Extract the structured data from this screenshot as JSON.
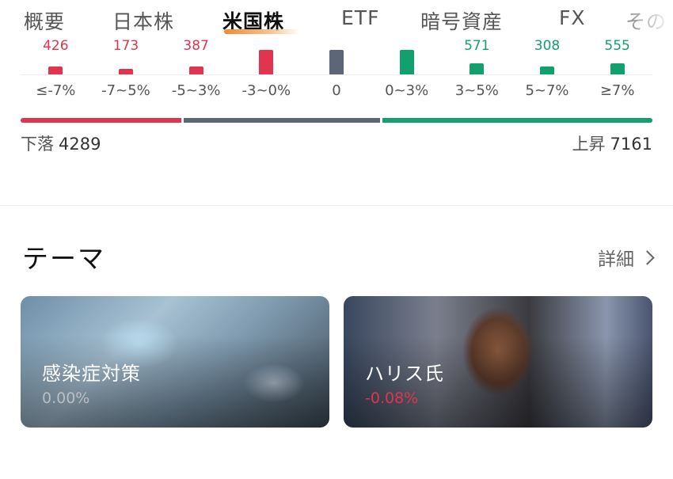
{
  "tabs": [
    {
      "label": "概要"
    },
    {
      "label": "日本株"
    },
    {
      "label": "米国株"
    },
    {
      "label": "ETF"
    },
    {
      "label": "暗号資産"
    },
    {
      "label": "FX"
    },
    {
      "label": "その"
    }
  ],
  "active_tab": "米国株",
  "distribution": {
    "buckets": [
      {
        "range": "≤-7%",
        "value": "426",
        "level": 0.28,
        "trend": "down"
      },
      {
        "range": "-7~5%",
        "value": "173",
        "level": 0.22,
        "trend": "down"
      },
      {
        "range": "-5~3%",
        "value": "387",
        "level": 0.28,
        "trend": "down"
      },
      {
        "range": "-3~0%",
        "value": "",
        "level": 0.9,
        "trend": "down"
      },
      {
        "range": "0",
        "value": "",
        "level": 0.9,
        "trend": "flat"
      },
      {
        "range": "0~3%",
        "value": "",
        "level": 0.9,
        "trend": "up"
      },
      {
        "range": "3~5%",
        "value": "571",
        "level": 0.4,
        "trend": "up"
      },
      {
        "range": "5~7%",
        "value": "308",
        "level": 0.3,
        "trend": "up"
      },
      {
        "range": "≥7%",
        "value": "555",
        "level": 0.42,
        "trend": "up"
      }
    ],
    "down_label": "下落",
    "down_count": "4289",
    "up_label": "上昇",
    "up_count": "7161"
  },
  "theme": {
    "title": "テーマ",
    "detail_label": "詳細",
    "cards": [
      {
        "name": "感染症対策",
        "change": "0.00%",
        "trend": "flat"
      },
      {
        "name": "ハリス氏",
        "change": "-0.08%",
        "trend": "down"
      }
    ]
  },
  "colors": {
    "down": "#e0344f",
    "flat": "#5c6678",
    "up": "#12a06e",
    "neutral_text": "#b9bec6"
  }
}
